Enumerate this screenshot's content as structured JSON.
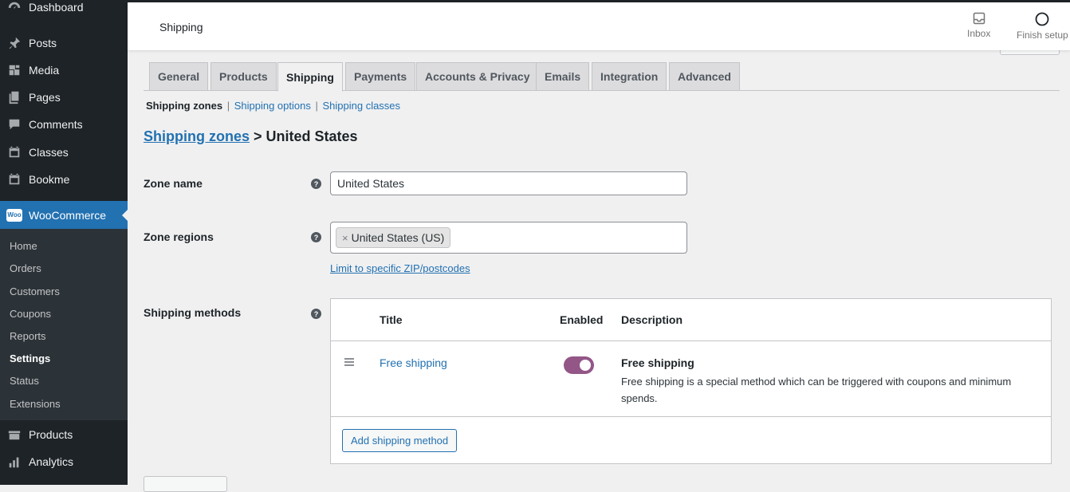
{
  "sidebar": {
    "items": [
      {
        "label": "Dashboard",
        "icon": "dashboard-icon"
      },
      {
        "label": "Posts",
        "icon": "pin-icon"
      },
      {
        "label": "Media",
        "icon": "media-icon"
      },
      {
        "label": "Pages",
        "icon": "pages-icon"
      },
      {
        "label": "Comments",
        "icon": "comment-icon"
      },
      {
        "label": "Classes",
        "icon": "calendar-icon"
      },
      {
        "label": "Bookme",
        "icon": "calendar-icon"
      }
    ],
    "woocommerce": "WooCommerce",
    "woo_badge": "Woo",
    "submenu": [
      "Home",
      "Orders",
      "Customers",
      "Coupons",
      "Reports",
      "Settings",
      "Status",
      "Extensions"
    ],
    "after": [
      {
        "label": "Products",
        "icon": "products-icon"
      },
      {
        "label": "Analytics",
        "icon": "analytics-icon"
      }
    ]
  },
  "header": {
    "title": "Shipping",
    "inbox": "Inbox",
    "finish_setup": "Finish setup"
  },
  "tabs": [
    "General",
    "Products",
    "Shipping",
    "Payments",
    "Accounts & Privacy",
    "Emails",
    "Integration",
    "Advanced"
  ],
  "subsub": {
    "current": "Shipping zones",
    "options": "Shipping options",
    "classes": "Shipping classes",
    "separator": "|"
  },
  "breadcrumb": {
    "link": "Shipping zones",
    "separator": ">",
    "current": "United States"
  },
  "form": {
    "zone_name_label": "Zone name",
    "zone_name_value": "United States",
    "zone_regions_label": "Zone regions",
    "region_chip": "United States (US)",
    "chip_remove": "×",
    "zip_link": "Limit to specific ZIP/postcodes",
    "shipping_methods_label": "Shipping methods",
    "help": "?"
  },
  "methods_table": {
    "headers": {
      "title": "Title",
      "enabled": "Enabled",
      "description": "Description"
    },
    "rows": [
      {
        "title": "Free shipping",
        "enabled": true,
        "desc_title": "Free shipping",
        "desc_text": "Free shipping is a special method which can be triggered with coupons and minimum spends."
      }
    ],
    "add_button": "Add shipping method"
  },
  "colors": {
    "sidebar_bg": "#1d2327",
    "accent": "#2271b1",
    "toggle_on": "#935687"
  }
}
